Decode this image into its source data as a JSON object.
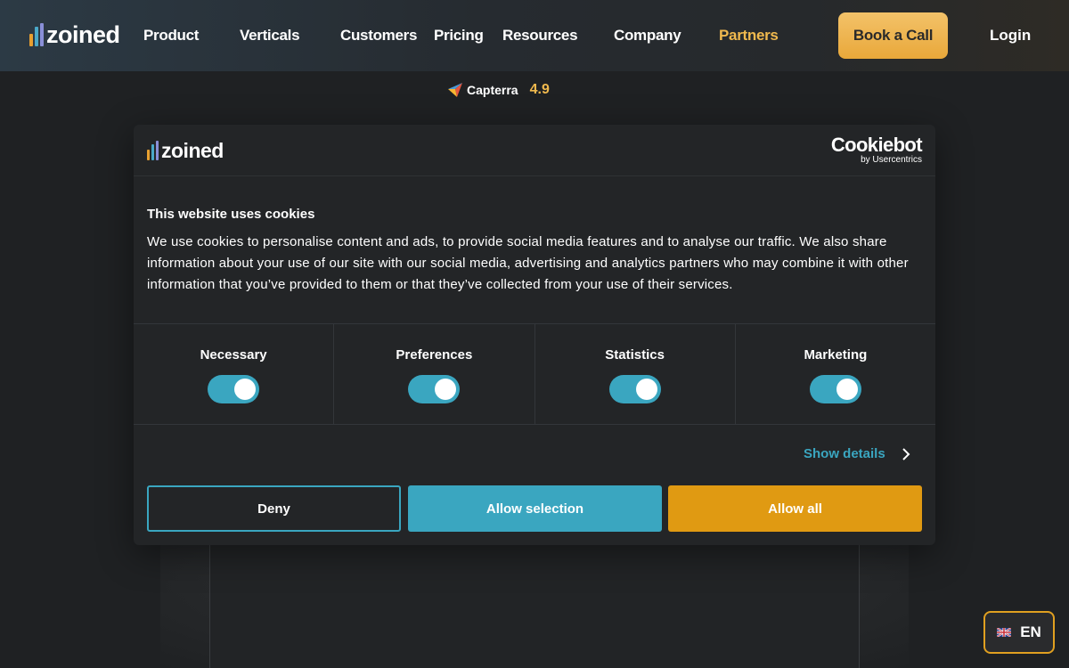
{
  "nav": {
    "logo_text": "zoined",
    "items": [
      "Product",
      "Verticals",
      "Customers",
      "Pricing",
      "Resources",
      "Company",
      "Partners"
    ],
    "book_label": "Book a Call",
    "login_label": "Login"
  },
  "rating": {
    "brand": "Capterra",
    "score": "4.9"
  },
  "cookie_dialog": {
    "logo_text": "zoined",
    "provider": "Cookiebot",
    "provider_sub": "by Usercentrics",
    "title": "This website uses cookies",
    "body": "We use cookies to personalise content and ads, to provide social media features and to analyse our traffic. We also share information about your use of our site with our social media, advertising and analytics partners who may combine it with other information that you’ve provided to them or that they’ve collected from your use of their services.",
    "categories": [
      {
        "label": "Necessary",
        "enabled": true
      },
      {
        "label": "Preferences",
        "enabled": true
      },
      {
        "label": "Statistics",
        "enabled": true
      },
      {
        "label": "Marketing",
        "enabled": true
      }
    ],
    "show_details": "Show details",
    "deny_label": "Deny",
    "allow_selection_label": "Allow selection",
    "allow_all_label": "Allow all"
  },
  "language": {
    "code": "EN"
  },
  "colors": {
    "accent_blue": "#3aa6c0",
    "accent_orange": "#e09a12",
    "partners_gold": "#f0b94e"
  },
  "icons": {
    "capterra": "capterra-arrow-icon",
    "chevron": "chevron-right-icon",
    "flag": "uk-flag-icon"
  }
}
